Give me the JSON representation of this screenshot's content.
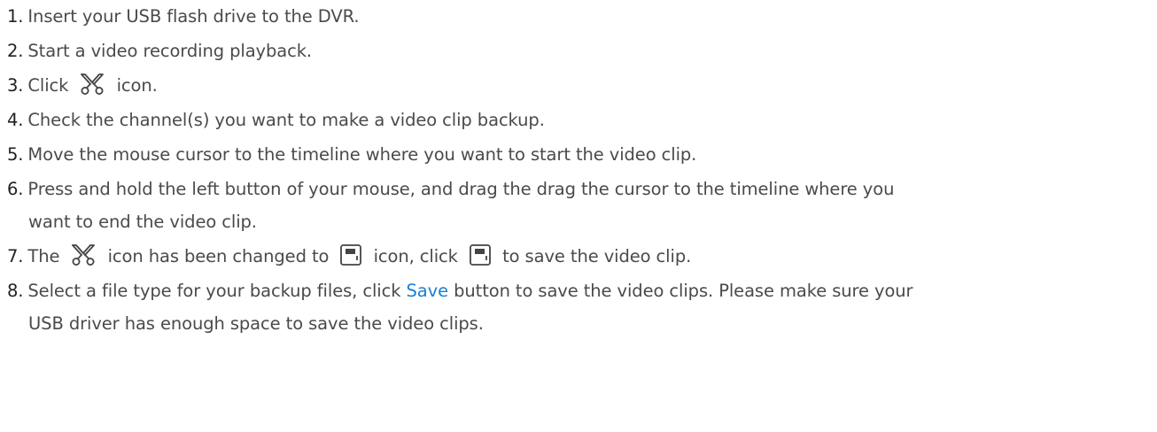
{
  "steps": [
    {
      "num": "1.",
      "text": "Insert your USB flash drive to the DVR."
    },
    {
      "num": "2.",
      "text": "Start a video recording playback."
    },
    {
      "num": "3.",
      "before": "Click",
      "icon": "scissors-icon",
      "after": "icon."
    },
    {
      "num": "4.",
      "text": "Check the channel(s) you want to make a video clip backup."
    },
    {
      "num": "5.",
      "text": "Move the mouse cursor to the timeline where you want to start the video clip."
    },
    {
      "num": "6.",
      "line1": "Press and hold the left button of your mouse, and drag the drag the cursor to the timeline where you",
      "line2": "want to end the video clip."
    },
    {
      "num": "7.",
      "p1": "The",
      "icon1": "scissors-icon",
      "p2": "icon has been changed to",
      "icon2": "save-icon",
      "p3": "icon, click",
      "icon3": "save-icon",
      "p4": "to save the video clip."
    },
    {
      "num": "8.",
      "p1": "Select a file type for your backup files, click",
      "link": "Save",
      "p2": "button to save the video clips. Please make sure your",
      "line2": "USB driver has enough space to save the video clips."
    }
  ],
  "colors": {
    "text": "#4a4a4a",
    "number": "#222222",
    "link": "#1a7fd4",
    "icon": "#444444"
  }
}
